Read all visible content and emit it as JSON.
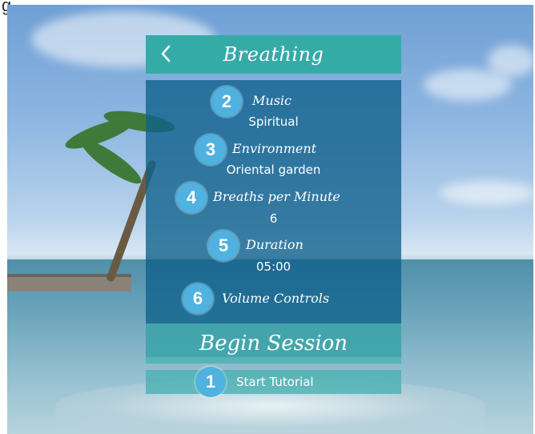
{
  "header": {
    "title": "Breathing"
  },
  "settings": {
    "music": {
      "number": "2",
      "label": "Music",
      "value": "Spiritual"
    },
    "environment": {
      "number": "3",
      "label": "Environment",
      "value": "Oriental garden"
    },
    "breaths": {
      "number": "4",
      "label": "Breaths per Minute",
      "value": "6"
    },
    "duration": {
      "number": "5",
      "label": "Duration",
      "value": "05:00"
    },
    "volume": {
      "number": "6",
      "label": "Volume Controls"
    }
  },
  "actions": {
    "begin_label": "Begin Session",
    "tutorial": {
      "number": "1",
      "label": "Start Tutorial"
    }
  },
  "icons": {
    "back": "chevron-left-icon"
  },
  "colors": {
    "header_bg": "#35aba8",
    "badge_bg": "#4fb2e0",
    "panel_bg": "#0e608c"
  }
}
